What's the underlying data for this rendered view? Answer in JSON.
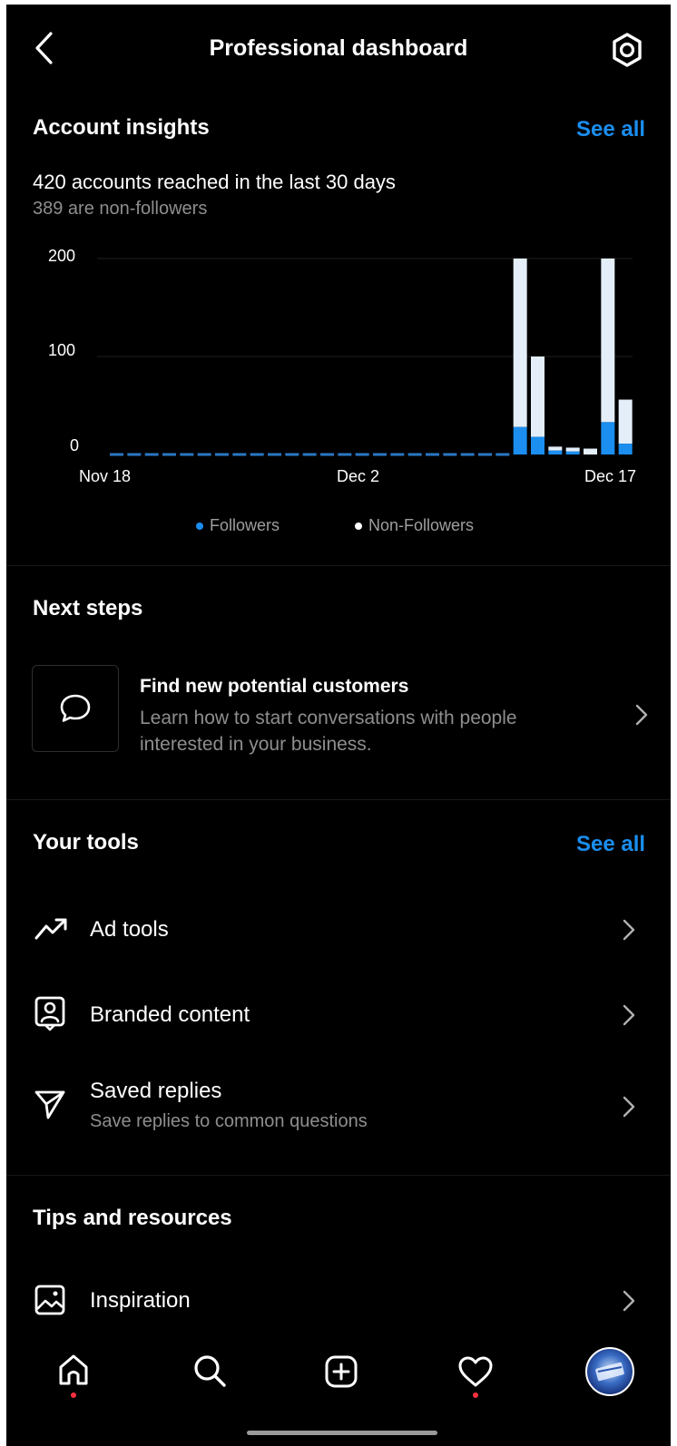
{
  "header": {
    "title": "Professional dashboard",
    "back_icon": "back-arrow-icon",
    "settings_icon": "settings-gear-icon"
  },
  "account_insights": {
    "title": "Account insights",
    "see_all": "See all",
    "reach_text": "420 accounts reached in the last 30 days",
    "sub_text": "389 are non-followers"
  },
  "chart_data": {
    "type": "bar",
    "stacked": true,
    "y_ticks": [
      "200",
      "100",
      "0"
    ],
    "ylim": [
      0,
      200
    ],
    "x_tick_labels": [
      "Nov 18",
      "Dec 2",
      "Dec 17"
    ],
    "categories": [
      "Nov 18",
      "Nov 19",
      "Nov 20",
      "Nov 21",
      "Nov 22",
      "Nov 23",
      "Nov 24",
      "Nov 25",
      "Nov 26",
      "Nov 27",
      "Nov 28",
      "Nov 29",
      "Nov 30",
      "Dec 1",
      "Dec 2",
      "Dec 3",
      "Dec 4",
      "Dec 5",
      "Dec 6",
      "Dec 7",
      "Dec 8",
      "Dec 9",
      "Dec 10",
      "Dec 11",
      "Dec 12",
      "Dec 13",
      "Dec 14",
      "Dec 15",
      "Dec 16",
      "Dec 17"
    ],
    "series": [
      {
        "name": "Followers",
        "color": "#1b8ef0",
        "values": [
          0,
          0,
          0,
          0,
          0,
          0,
          0,
          0,
          0,
          0,
          0,
          0,
          0,
          0,
          0,
          0,
          0,
          0,
          0,
          0,
          0,
          0,
          0,
          28,
          18,
          4,
          3,
          0,
          33,
          11
        ]
      },
      {
        "name": "Non-Followers",
        "color": "#e3eef8",
        "values": [
          0,
          0,
          0,
          0,
          0,
          0,
          0,
          0,
          0,
          0,
          0,
          0,
          0,
          0,
          0,
          0,
          0,
          0,
          0,
          0,
          0,
          0,
          0,
          172,
          82,
          4,
          4,
          6,
          167,
          45
        ]
      }
    ],
    "grid": true
  },
  "legend": {
    "followers": "Followers",
    "non_followers": "Non-Followers",
    "followers_color": "#1b8ef0",
    "non_followers_color": "#e3eef8"
  },
  "next_steps": {
    "title": "Next steps",
    "card_icon": "chat-bubble-icon",
    "card_title": "Find new potential customers",
    "card_desc_line1": "Learn how to start conversations with people",
    "card_desc_line2": "interested in your business."
  },
  "your_tools": {
    "title": "Your tools",
    "see_all": "See all",
    "items": [
      {
        "label": "Ad tools",
        "icon": "trending-up-icon"
      },
      {
        "label": "Branded content",
        "icon": "person-badge-icon"
      },
      {
        "label": "Saved replies",
        "sub": "Save replies to common questions",
        "icon": "send-icon"
      }
    ]
  },
  "tips": {
    "title": "Tips and resources",
    "items": [
      {
        "label": "Inspiration",
        "icon": "image-icon"
      }
    ]
  },
  "bottom_nav": {
    "items": [
      "home-icon",
      "search-icon",
      "create-icon",
      "activity-heart-icon",
      "profile-avatar"
    ]
  },
  "colors": {
    "accent": "#1b8ef0",
    "background": "#000000",
    "secondary_text": "#8e8e8e",
    "notification": "#ff3040"
  }
}
